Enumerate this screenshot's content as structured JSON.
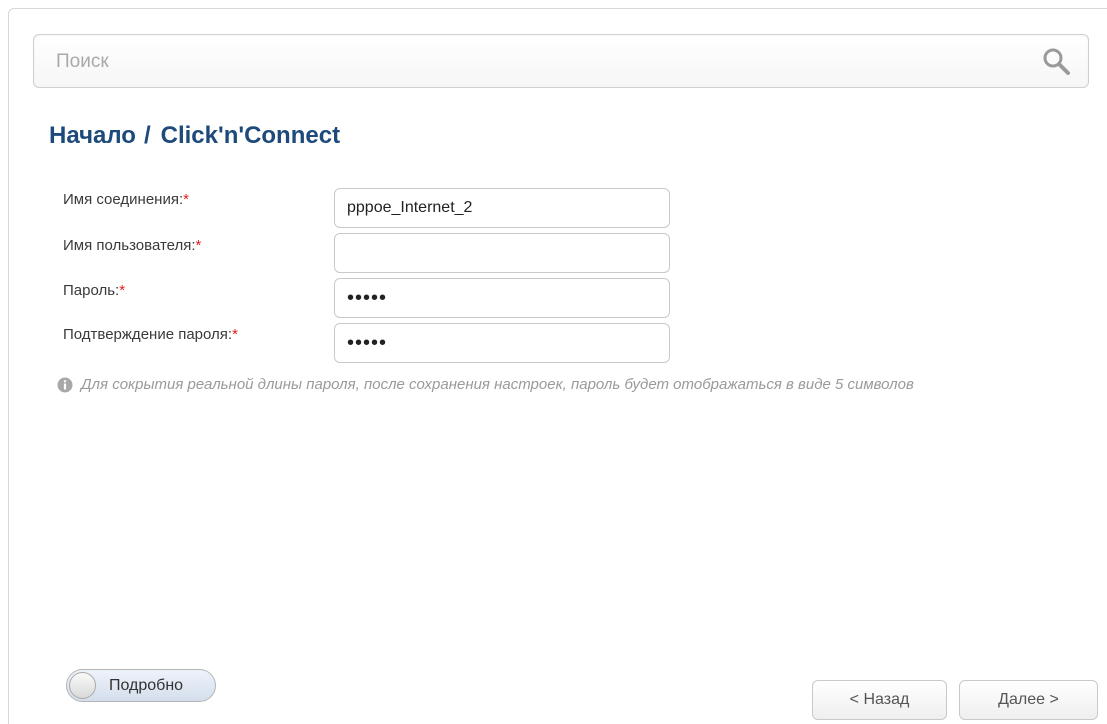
{
  "search": {
    "placeholder": "Поиск",
    "value": ""
  },
  "breadcrumb": {
    "root": "Начало",
    "separator": "/",
    "current": "Click'n'Connect"
  },
  "form": {
    "required_mark": "*",
    "fields": [
      {
        "label": "Имя соединения:",
        "value": "pppoe_Internet_2"
      },
      {
        "label": "Имя пользователя:",
        "value": ""
      },
      {
        "label": "Пароль:",
        "value": "•••••"
      },
      {
        "label": "Подтверждение пароля:",
        "value": "•••••"
      }
    ]
  },
  "hint": {
    "text": "Для сокрытия реальной длины пароля, после сохранения настроек, пароль будет отображаться в виде 5 символов"
  },
  "toggle": {
    "label": "Подробно",
    "state": "off"
  },
  "buttons": {
    "back": "< Назад",
    "next": "Далее >"
  },
  "colors": {
    "title": "#1d4a7a",
    "required": "#e02020",
    "hint": "#9a9a9a"
  },
  "icons": {
    "search": "search-icon",
    "info": "info-icon"
  }
}
